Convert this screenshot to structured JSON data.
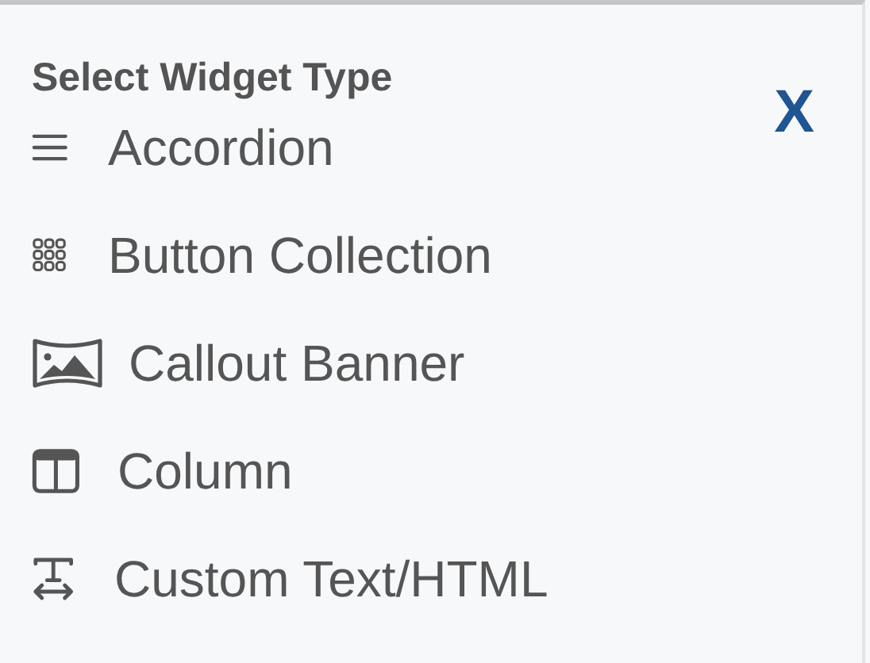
{
  "panel": {
    "title": "Select Widget Type",
    "close": "X"
  },
  "widgets": [
    {
      "label": "Accordion",
      "kind": "lines"
    },
    {
      "label": "Button Collection",
      "kind": "grid"
    },
    {
      "label": "Callout Banner",
      "kind": "banner"
    },
    {
      "label": "Column",
      "kind": "columns"
    },
    {
      "label": "Custom Text/HTML",
      "kind": "text"
    }
  ]
}
